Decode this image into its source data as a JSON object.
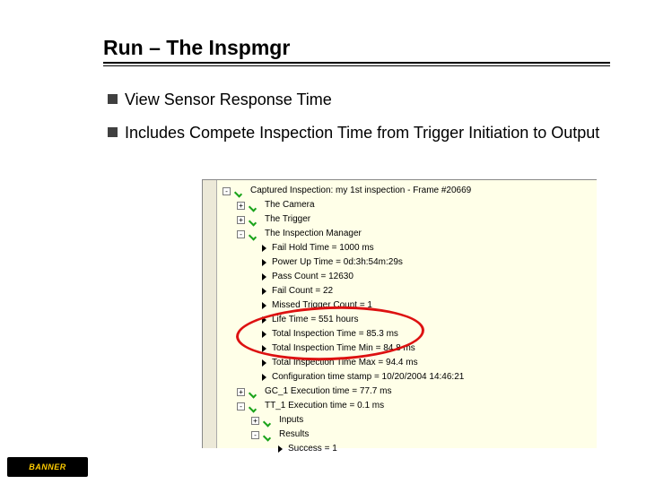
{
  "title": "Run – The Inspmgr",
  "bullets": [
    "View Sensor Response Time",
    "Includes Compete Inspection Time from Trigger Initiation to Output"
  ],
  "logo_text": "BANNER",
  "tree": {
    "root": "Captured Inspection: my 1st inspection - Frame #20669",
    "camera": "The Camera",
    "trigger": "The Trigger",
    "inspmgr": "The Inspection Manager",
    "inspmgr_items": [
      "Fail Hold Time = 1000 ms",
      "Power Up Time = 0d:3h:54m:29s",
      "Pass Count = 12630",
      "Fail Count = 22",
      "Missed Trigger Count = 1",
      "Life Time = 551 hours",
      "Total Inspection Time = 85.3 ms",
      "Total Inspection Time Min = 84.8 ms",
      "Total Inspection Time Max = 94.4 ms",
      "Configuration time stamp = 10/20/2004 14:46:21"
    ],
    "gc": "GC_1 Execution time = 77.7 ms",
    "tt": "TT_1 Execution time = 0.1 ms",
    "inputs": "Inputs",
    "results": "Results",
    "success": "Success = 1"
  }
}
